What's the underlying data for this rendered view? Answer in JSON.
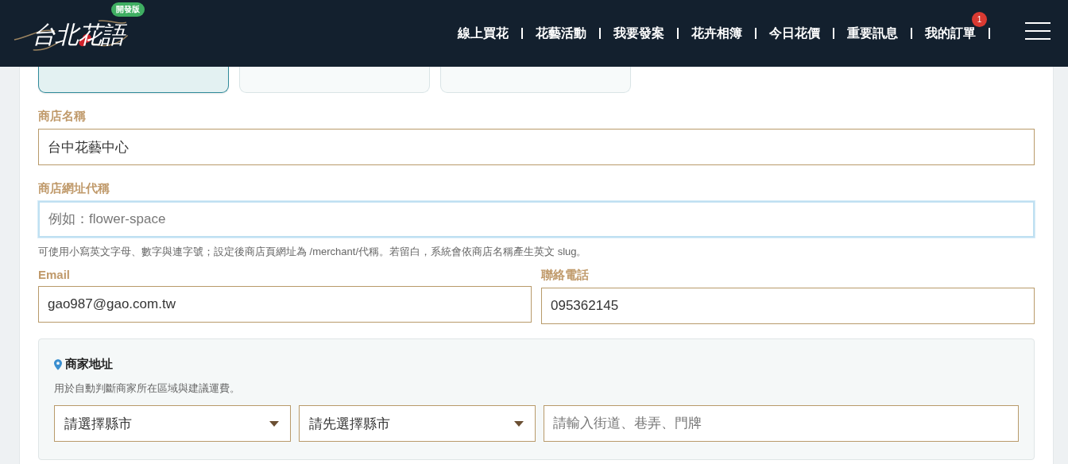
{
  "header": {
    "logo_text": "台北花語",
    "badge": "開發版",
    "nav": [
      {
        "label": "線上買花"
      },
      {
        "label": "花藝活動"
      },
      {
        "label": "我要發案"
      },
      {
        "label": "花卉相簿"
      },
      {
        "label": "今日花價"
      },
      {
        "label": "重要訊息"
      },
      {
        "label": "我的訂單",
        "badge": "1"
      }
    ]
  },
  "category_tabs": [
    {
      "selected": true
    },
    {
      "selected": false
    },
    {
      "selected": false
    }
  ],
  "store_name": {
    "label": "商店名稱",
    "value": "台中花藝中心"
  },
  "store_slug": {
    "label": "商店網址代稱",
    "placeholder": "例如：flower-space",
    "focused": true,
    "help": "可使用小寫英文字母、數字與連字號；設定後商店頁網址為 /merchant/代稱。若留白，系統會依商店名稱產生英文 slug。"
  },
  "email": {
    "label": "Email",
    "value": "gao987@gao.com.tw"
  },
  "phone": {
    "label": "聯絡電話",
    "value": "095362145"
  },
  "address": {
    "title": "商家地址",
    "description": "用於自動判斷商家所在區域與建議運費。",
    "city": "請選擇縣市",
    "district": "請先選擇縣市",
    "street_placeholder": "請輸入街道、巷弄、門牌"
  }
}
